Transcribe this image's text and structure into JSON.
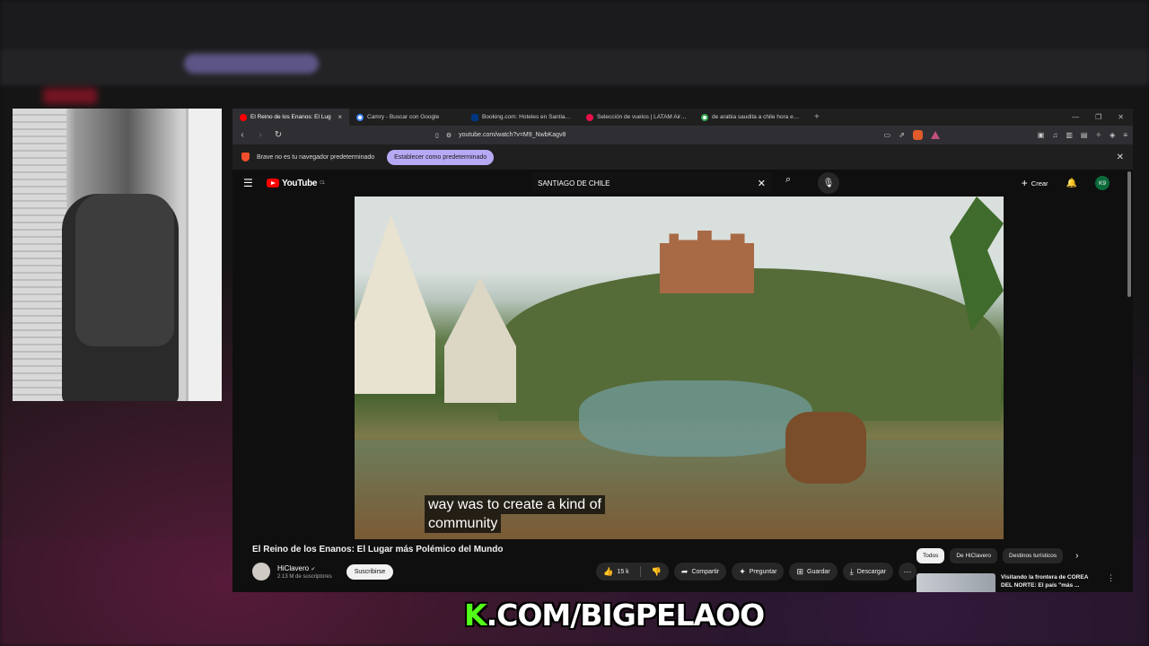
{
  "overlay": {
    "brand_letter": "K",
    "text": ".COM/BIGPELAOO",
    "accent_color": "#53fc18"
  },
  "browser": {
    "tabs": [
      {
        "label": "El Reino de los Enanos: El Lug",
        "favicon": "youtube-icon",
        "active": true
      },
      {
        "label": "Camry - Buscar con Google",
        "favicon": "google-icon",
        "active": false
      },
      {
        "label": "Booking.com: Hoteles en Santiago.",
        "favicon": "booking-icon",
        "active": false
      },
      {
        "label": "Selección de vuelos | LATAM Airlines",
        "favicon": "latam-icon",
        "active": false
      },
      {
        "label": "de arabia saudita a chile hora en avi",
        "favicon": "google-icon",
        "active": false
      }
    ],
    "url": "youtube.com/watch?v=M9_NwbKagv8",
    "infobar": {
      "message": "Brave no es tu navegador predeterminado",
      "button": "Establecer como predeterminado"
    }
  },
  "youtube": {
    "logo": "YouTube",
    "country": "CL",
    "search_value": "SANTIAGO DE CHILE",
    "create_label": "Crear",
    "avatar": "K9",
    "caption_lines": [
      "way was to create a kind of",
      "community"
    ],
    "video_title": "El Reino de los Enanos: El Lugar más Polémico del Mundo",
    "channel": {
      "name": "HiClavero",
      "subscribers": "2.13 M de suscriptores",
      "subscribe_label": "Suscribirse"
    },
    "actions": {
      "likes": "15 k",
      "share": "Compartir",
      "ask": "Preguntar",
      "save": "Guardar",
      "download": "Descargar"
    },
    "chips": [
      "Todos",
      "De HiClavero",
      "Destinos turísticos"
    ],
    "recommendation": {
      "title": "Visitando la frontera de COREA DEL NORTE: El país \"más ..."
    }
  }
}
